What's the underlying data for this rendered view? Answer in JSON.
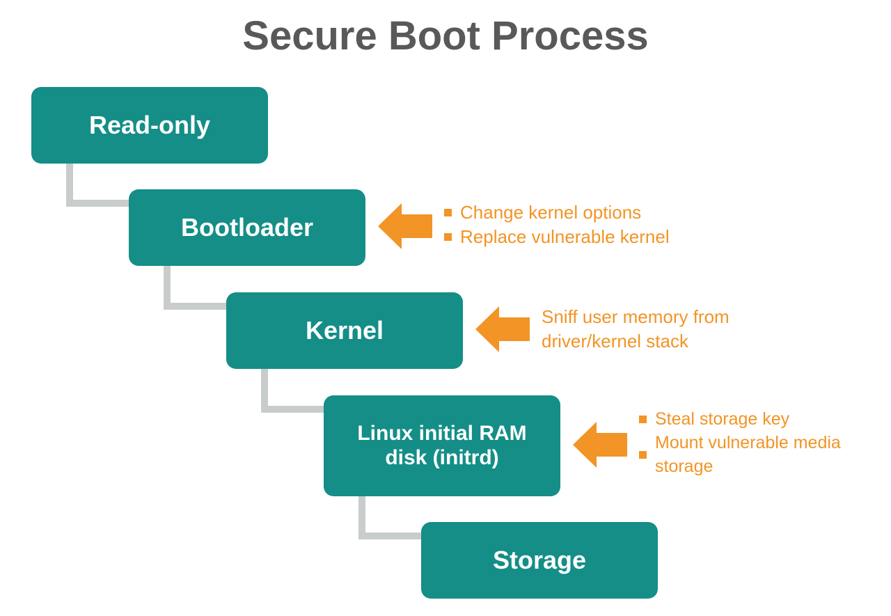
{
  "title": "Secure Boot Process",
  "colors": {
    "box": "#148e87",
    "accent": "#f29426",
    "title": "#595959",
    "connector": "#c9cccd"
  },
  "boxes": {
    "b0": {
      "label": "Read-only"
    },
    "b1": {
      "label": "Bootloader"
    },
    "b2": {
      "label": "Kernel"
    },
    "b3": {
      "label_line1": "Linux initial RAM",
      "label_line2": "disk (initrd)"
    },
    "b4": {
      "label": "Storage"
    }
  },
  "annotations": {
    "a1": {
      "items": [
        "Change kernel options",
        "Replace vulnerable kernel"
      ]
    },
    "a2": {
      "text_line1": "Sniff user memory from",
      "text_line2": "driver/kernel stack"
    },
    "a3": {
      "items": [
        "Steal storage key",
        "Mount vulnerable media storage"
      ]
    }
  }
}
